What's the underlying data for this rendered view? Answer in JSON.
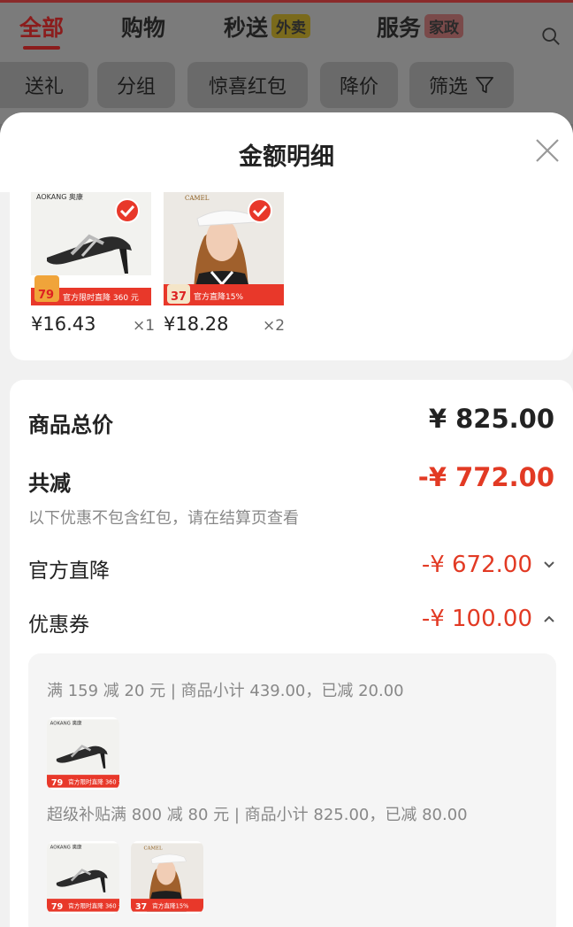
{
  "background": {
    "tabs": [
      {
        "label": "全部",
        "active": true
      },
      {
        "label": "购物",
        "active": false
      },
      {
        "label": "秒送",
        "tag": "外卖",
        "active": false
      },
      {
        "label": "服务",
        "tag": "家政",
        "active": false
      }
    ],
    "filters": [
      "送礼",
      "分组",
      "惊喜红包",
      "降价",
      "筛选"
    ]
  },
  "sheet": {
    "title": "金额明细",
    "products": [
      {
        "brand": "AOKANG 奥康",
        "badge_price": "79",
        "banner": "官方限时直降 360 元",
        "price": "¥16.43",
        "qty": "×1",
        "icon": "sandal-image"
      },
      {
        "brand": "CAMEL",
        "badge_price": "37",
        "banner": "官方直降15%",
        "price": "¥18.28",
        "qty": "×2",
        "icon": "woman-cap-image"
      }
    ],
    "summary": {
      "total_label": "商品总价",
      "total_value": "¥ 825.00",
      "reduce_label": "共减",
      "reduce_value": "-¥ 772.00",
      "note": "以下优惠不包含红包，请在结算页查看",
      "official_label": "官方直降",
      "official_value": "-¥ 672.00",
      "coupon_label": "优惠券",
      "coupon_value": "-¥ 100.00"
    },
    "coupons": [
      {
        "text": "满 159 减 20 元 | 商品小计 439.00，已减 20.00"
      },
      {
        "text": "超级补贴满 800 减 80 元 | 商品小计 825.00，已减 80.00"
      }
    ]
  },
  "colors": {
    "accent_red": "#e23a24",
    "check_red": "#e8382a"
  }
}
